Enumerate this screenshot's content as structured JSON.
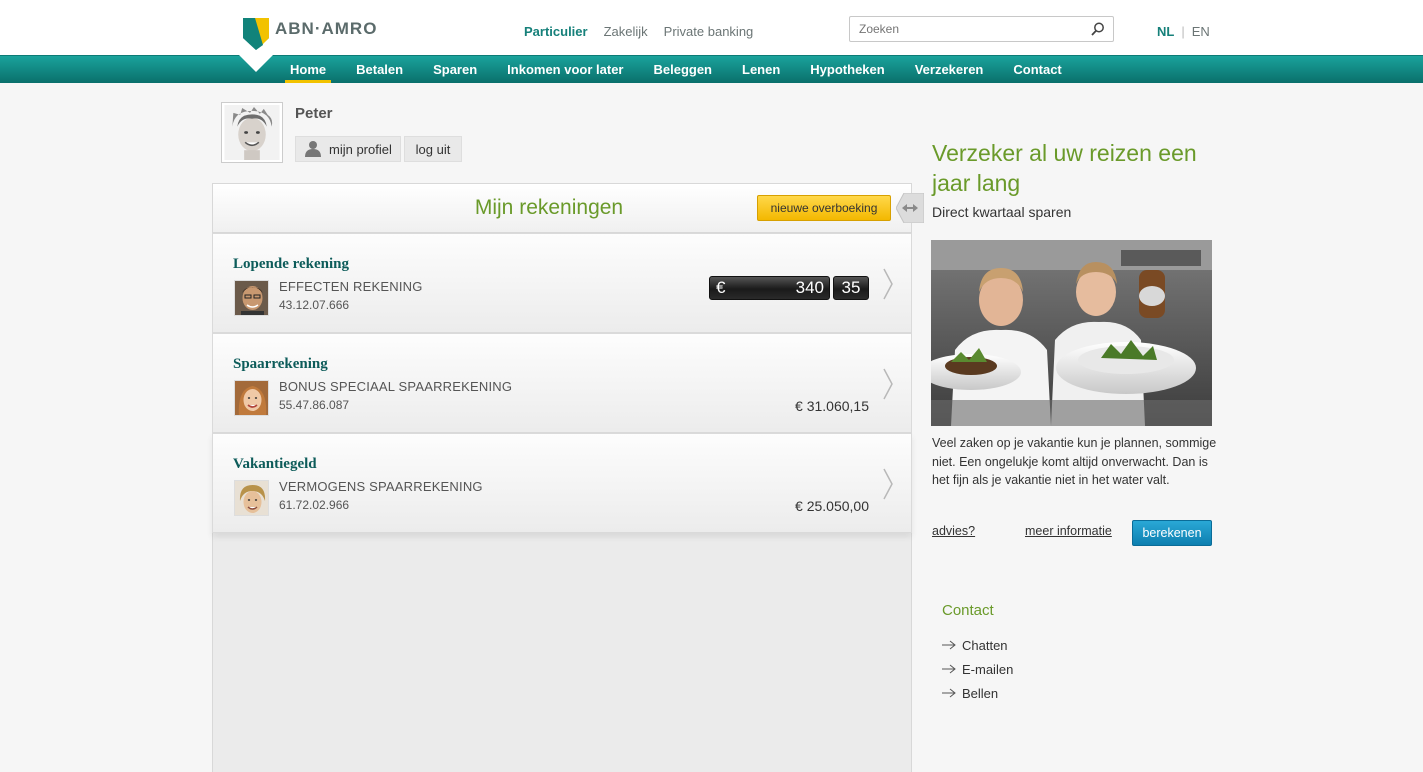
{
  "header": {
    "brand": "ABN·AMRO",
    "segments": [
      "Particulier",
      "Zakelijk",
      "Private banking"
    ],
    "active_segment": "Particulier",
    "search": {
      "placeholder": "Zoeken"
    },
    "languages": {
      "active": "NL",
      "other": "EN"
    }
  },
  "nav": {
    "items": [
      "Home",
      "Betalen",
      "Sparen",
      "Inkomen voor later",
      "Beleggen",
      "Lenen",
      "Hypotheken",
      "Verzekeren",
      "Contact"
    ],
    "active": "Home"
  },
  "user": {
    "name": "Peter",
    "profile_label": "mijn profiel",
    "logout_label": "log uit"
  },
  "accounts": {
    "title": "Mijn rekeningen",
    "transfer_label": "nieuwe overboeking",
    "items": [
      {
        "name": "Lopende rekening",
        "type": "EFFECTEN REKENING",
        "number": "43.12.07.666",
        "counter": {
          "currency": "€",
          "units": "340",
          "cents": "35"
        }
      },
      {
        "name": "Spaarrekening",
        "type": "BONUS SPECIAAL SPAARREKENING",
        "number": "55.47.86.087",
        "balance": "€ 31.060,15"
      },
      {
        "name": "Vakantiegeld",
        "type": "VERMOGENS SPAARREKENING",
        "number": "61.72.02.966",
        "balance": "€ 25.050,00"
      }
    ]
  },
  "promo": {
    "title": "Verzeker al uw reizen een jaar lang",
    "subtitle": "Direct kwartaal sparen",
    "body": "Veel zaken op je vakantie kun je plannen, sommige niet. Een ongelukje komt altijd onverwacht. Dan is het fijn als je vakantie niet in het water valt.",
    "advies_label": "advies?",
    "meer_label": "meer informatie",
    "calc_label": "berekenen"
  },
  "contact": {
    "title": "Contact",
    "items": [
      "Chatten",
      "E-mailen",
      "Bellen"
    ]
  },
  "colors": {
    "brand_teal": "#16807a",
    "nav_teal": "#0a6f6b",
    "accent_green": "#6a9a2a",
    "button_yellow": "#f3b800",
    "button_blue": "#0d7fb0"
  },
  "icons": [
    "abn-amro-shield-icon",
    "search-icon",
    "user-icon",
    "swap-arrows-icon",
    "chevron-right-icon",
    "arrow-right-icon"
  ]
}
